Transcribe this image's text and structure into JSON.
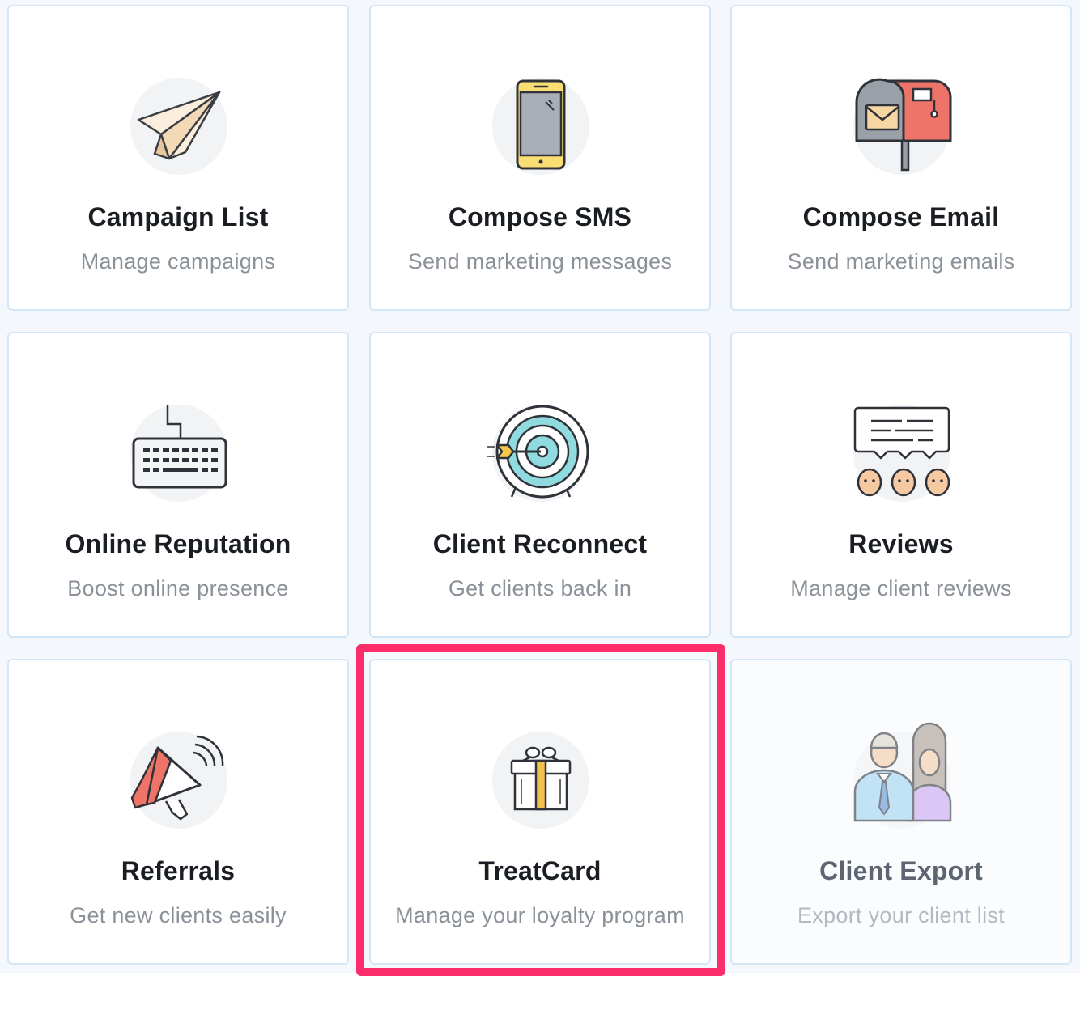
{
  "cards": [
    {
      "title": "Campaign List",
      "subtitle": "Manage campaigns",
      "icon": "paper-plane-icon"
    },
    {
      "title": "Compose SMS",
      "subtitle": "Send marketing messages",
      "icon": "smartphone-icon"
    },
    {
      "title": "Compose Email",
      "subtitle": "Send marketing emails",
      "icon": "mailbox-icon"
    },
    {
      "title": "Online Reputation",
      "subtitle": "Boost online presence",
      "icon": "keyboard-icon"
    },
    {
      "title": "Client Reconnect",
      "subtitle": "Get clients back in",
      "icon": "target-icon"
    },
    {
      "title": "Reviews",
      "subtitle": "Manage client reviews",
      "icon": "reviews-chat-icon"
    },
    {
      "title": "Referrals",
      "subtitle": "Get new clients easily",
      "icon": "megaphone-icon"
    },
    {
      "title": "TreatCard",
      "subtitle": "Manage your loyalty program",
      "icon": "gift-icon"
    },
    {
      "title": "Client Export",
      "subtitle": "Export your client list",
      "icon": "people-icon"
    }
  ],
  "highlighted_card": "TreatCard",
  "colors": {
    "highlight": "#fb2e6b",
    "card_border": "#d3e6f6",
    "title": "#1a1d22",
    "subtitle": "#8b9199"
  }
}
